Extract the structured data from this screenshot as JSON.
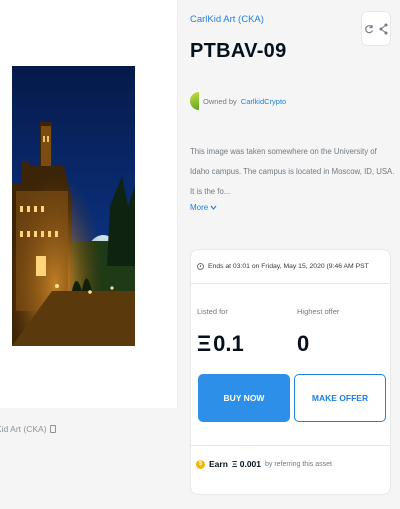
{
  "left": {
    "collection_credit": "Kid Art (CKA)"
  },
  "asset": {
    "collection": "CarlKid Art (CKA)",
    "title": "PTBAV-09",
    "owner_prefix": "Owned by",
    "owner_name": "CarlkidCrypto",
    "description": "This image was taken somewhere on the University of Idaho campus. The campus is located in Moscow, ID, USA. It is the fo...",
    "more_label": "More"
  },
  "sale": {
    "ends_text": "Ends at 03:01 on Friday, May 15, 2020 (9:46 AM PST",
    "listed_label": "Listed for",
    "listed_value": "0.1",
    "offer_label": "Highest offer",
    "offer_value": "0",
    "buy_label": "BUY NOW",
    "offer_button_label": "MAKE OFFER",
    "earn_prefix": "Earn",
    "earn_value": "Ξ 0.001",
    "earn_suffix": "by referring this asset"
  },
  "icons": {
    "refresh": "refresh-icon",
    "share": "share-icon",
    "clock": "clock-icon",
    "eth": "eth-icon",
    "coin": "coin-icon"
  },
  "colors": {
    "accent": "#2081e2",
    "buy_button": "#2d8fe8",
    "coin": "#f2b705"
  }
}
